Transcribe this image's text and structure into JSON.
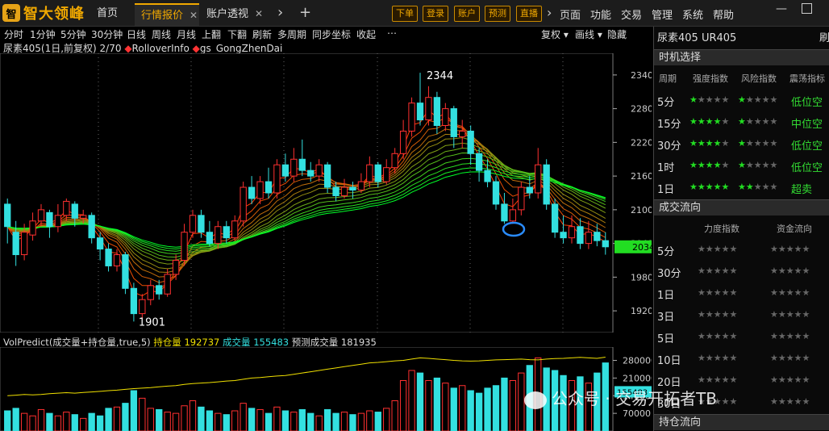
{
  "app": {
    "logo_mark": "智",
    "name": "智大领峰"
  },
  "tabs": [
    {
      "label": "首页",
      "close": ""
    },
    {
      "label": "行情报价",
      "close": "✕"
    },
    {
      "label": "账户透视",
      "close": "✕"
    }
  ],
  "top_buttons": [
    "下单",
    "登录",
    "账户",
    "预测",
    "直播"
  ],
  "menu": [
    "页面",
    "功能",
    "交易",
    "管理",
    "系统",
    "帮助"
  ],
  "toolbar": {
    "periods": [
      "分时",
      "1分钟",
      "5分钟",
      "30分钟",
      "日线",
      "周线",
      "月线"
    ],
    "actions": [
      "上翻",
      "下翻",
      "刷新",
      "多周期",
      "同步坐标",
      "收起"
    ],
    "more": "⋯",
    "right": [
      "复权 ▾",
      "画线 ▾",
      "隐藏"
    ]
  },
  "chart_info": {
    "symbol": "尿素405(1日,前复权) 2/70",
    "ind1": "RolloverInfo",
    "ind2": "gs_GongZhenDai"
  },
  "chart_data": {
    "type": "candlestick",
    "ylim": [
      1890,
      2370
    ],
    "y_ticks": [
      2340,
      2280,
      2220,
      2160,
      2100,
      2040,
      1980,
      1920
    ],
    "high_label": "2344",
    "low_label": "1901",
    "last_price": "2034",
    "candles": [
      [
        2110,
        2070,
        2120,
        2040
      ],
      [
        2060,
        2020,
        2080,
        2000
      ],
      [
        2020,
        2060,
        2075,
        2010
      ],
      [
        2055,
        2080,
        2095,
        2045
      ],
      [
        2080,
        2100,
        2110,
        2070
      ],
      [
        2095,
        2070,
        2100,
        2050
      ],
      [
        2070,
        2090,
        2110,
        2060
      ],
      [
        2090,
        2115,
        2120,
        2080
      ],
      [
        2110,
        2085,
        2115,
        2070
      ],
      [
        2085,
        2090,
        2100,
        2075
      ],
      [
        2090,
        2050,
        2095,
        2040
      ],
      [
        2050,
        2030,
        2060,
        2010
      ],
      [
        2030,
        2000,
        2040,
        1990
      ],
      [
        2000,
        2020,
        2030,
        1990
      ],
      [
        2020,
        1960,
        2025,
        1950
      ],
      [
        1960,
        1915,
        1970,
        1901
      ],
      [
        1915,
        1940,
        1950,
        1905
      ],
      [
        1940,
        1965,
        1975,
        1930
      ],
      [
        1965,
        1950,
        1975,
        1940
      ],
      [
        1950,
        1985,
        1995,
        1945
      ],
      [
        1985,
        2010,
        2020,
        1975
      ],
      [
        2010,
        2060,
        2075,
        2000
      ],
      [
        2060,
        2090,
        2100,
        2050
      ],
      [
        2090,
        2060,
        2100,
        2050
      ],
      [
        2060,
        2040,
        2080,
        2035
      ],
      [
        2040,
        2070,
        2080,
        2030
      ],
      [
        2070,
        2050,
        2080,
        2040
      ],
      [
        2050,
        2080,
        2090,
        2045
      ],
      [
        2080,
        2140,
        2150,
        2070
      ],
      [
        2140,
        2120,
        2160,
        2110
      ],
      [
        2120,
        2150,
        2160,
        2110
      ],
      [
        2150,
        2130,
        2175,
        2120
      ],
      [
        2130,
        2180,
        2190,
        2120
      ],
      [
        2180,
        2160,
        2200,
        2150
      ],
      [
        2160,
        2190,
        2210,
        2150
      ],
      [
        2190,
        2170,
        2225,
        2160
      ],
      [
        2170,
        2160,
        2185,
        2150
      ],
      [
        2160,
        2180,
        2190,
        2150
      ],
      [
        2180,
        2140,
        2185,
        2130
      ],
      [
        2140,
        2125,
        2150,
        2115
      ],
      [
        2125,
        2140,
        2155,
        2120
      ],
      [
        2140,
        2135,
        2150,
        2120
      ],
      [
        2135,
        2150,
        2165,
        2130
      ],
      [
        2150,
        2180,
        2195,
        2140
      ],
      [
        2180,
        2150,
        2185,
        2140
      ],
      [
        2150,
        2175,
        2190,
        2145
      ],
      [
        2175,
        2200,
        2210,
        2165
      ],
      [
        2200,
        2240,
        2260,
        2190
      ],
      [
        2240,
        2290,
        2300,
        2230
      ],
      [
        2290,
        2260,
        2344,
        2250
      ],
      [
        2260,
        2300,
        2320,
        2250
      ],
      [
        2300,
        2250,
        2310,
        2235
      ],
      [
        2250,
        2280,
        2290,
        2240
      ],
      [
        2280,
        2230,
        2285,
        2210
      ],
      [
        2230,
        2240,
        2260,
        2210
      ],
      [
        2240,
        2200,
        2250,
        2180
      ],
      [
        2200,
        2170,
        2210,
        2150
      ],
      [
        2170,
        2150,
        2190,
        2140
      ],
      [
        2150,
        2110,
        2160,
        2100
      ],
      [
        2110,
        2080,
        2130,
        2075
      ],
      [
        2080,
        2100,
        2120,
        2075
      ],
      [
        2100,
        2140,
        2150,
        2090
      ],
      [
        2140,
        2130,
        2160,
        2120
      ],
      [
        2130,
        2180,
        2210,
        2120
      ],
      [
        2180,
        2110,
        2190,
        2100
      ],
      [
        2110,
        2060,
        2120,
        2050
      ],
      [
        2060,
        2050,
        2090,
        2040
      ],
      [
        2050,
        2070,
        2090,
        2040
      ],
      [
        2070,
        2040,
        2085,
        2030
      ],
      [
        2040,
        2060,
        2080,
        2030
      ],
      [
        2060,
        2045,
        2075,
        2035
      ],
      [
        2045,
        2034,
        2060,
        2020
      ]
    ],
    "volume_info": {
      "label": "VolPredict(成交量+持仓量,true,5)",
      "oi_label": "持仓量",
      "oi": "192737",
      "vol_label": "成交量",
      "vol": "155483",
      "pred_label": "预测成交量",
      "pred": "181935"
    },
    "vol_ticks": [
      280000,
      210000,
      140000,
      70000
    ],
    "vol_last": "155483",
    "vol_ylim": [
      0,
      320000
    ],
    "volumes": [
      80000,
      90000,
      70000,
      60000,
      85000,
      70000,
      60000,
      75000,
      65000,
      50000,
      70000,
      60000,
      90000,
      95000,
      110000,
      160000,
      130000,
      90000,
      85000,
      75000,
      70000,
      100000,
      120000,
      95000,
      80000,
      70000,
      65000,
      80000,
      110000,
      90000,
      85000,
      70000,
      95000,
      80000,
      75000,
      85000,
      70000,
      60000,
      85000,
      70000,
      75000,
      65000,
      70000,
      80000,
      75000,
      90000,
      120000,
      200000,
      240000,
      230000,
      200000,
      210000,
      190000,
      170000,
      180000,
      160000,
      150000,
      170000,
      180000,
      210000,
      200000,
      230000,
      260000,
      290000,
      250000,
      240000,
      220000,
      200000,
      215000,
      190000,
      230000,
      270000
    ],
    "open_interest": [
      140000,
      142000,
      145000,
      143000,
      145000,
      148000,
      150000,
      152000,
      150000,
      153000,
      155000,
      157000,
      160000,
      162000,
      165000,
      168000,
      170000,
      172000,
      175000,
      178000,
      180000,
      185000,
      188000,
      190000,
      192000,
      195000,
      198000,
      200000,
      205000,
      210000,
      212000,
      215000,
      218000,
      220000,
      225000,
      230000,
      235000,
      240000,
      245000,
      250000,
      255000,
      260000,
      265000,
      270000,
      272000,
      275000,
      278000,
      280000,
      285000,
      290000,
      288000,
      285000,
      283000,
      280000,
      278000,
      277000,
      278000,
      280000,
      282000,
      283000,
      284000,
      285000,
      283000,
      282000,
      285000,
      287000,
      288000,
      290000,
      292000,
      290000,
      288000,
      292737
    ]
  },
  "right_panel": {
    "title": "尿素405 UR405",
    "edge_label": "刷",
    "sec_time": "时机选择",
    "hdr_period": "周期",
    "hdr_strength": "强度指数",
    "hdr_risk": "风险指数",
    "hdr_shock": "震荡指标",
    "timing_rows": [
      {
        "period": "5分",
        "s1": 1,
        "s2": 1,
        "level": "低位空"
      },
      {
        "period": "15分",
        "s1": 4,
        "s2": 1,
        "level": "中位空"
      },
      {
        "period": "30分",
        "s1": 4,
        "s2": 1,
        "level": "低位空"
      },
      {
        "period": "1时",
        "s1": 4,
        "s2": 1,
        "level": "低位空"
      },
      {
        "period": "1日",
        "s1": 5,
        "s2": 2,
        "level": "超卖"
      }
    ],
    "sec_flow": "成交流向",
    "hdr_force": "力度指数",
    "hdr_fund": "资金流向",
    "flow_rows": [
      "5分",
      "30分",
      "1日",
      "3日",
      "5日",
      "10日",
      "20日",
      "30日"
    ],
    "sec_oi": "持仓流向"
  },
  "watermark": "公众号 · 交易开拓者TB"
}
